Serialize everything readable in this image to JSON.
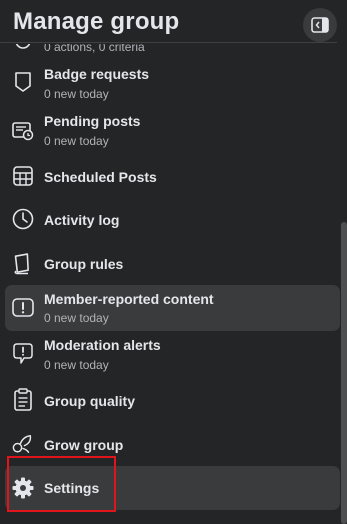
{
  "header": {
    "title": "Manage group"
  },
  "top_partial": {
    "subtitle": "0 actions, 0 criteria"
  },
  "menu": [
    {
      "label": "Badge requests",
      "subtitle": "0 new today",
      "icon": "badge-icon"
    },
    {
      "label": "Pending posts",
      "subtitle": "0 new today",
      "icon": "pending-posts-icon"
    },
    {
      "label": "Scheduled Posts",
      "subtitle": "",
      "icon": "calendar-icon"
    },
    {
      "label": "Activity log",
      "subtitle": "",
      "icon": "clock-icon"
    },
    {
      "label": "Group rules",
      "subtitle": "",
      "icon": "book-icon"
    },
    {
      "label": "Member-reported content",
      "subtitle": "0 new today",
      "icon": "report-icon"
    },
    {
      "label": "Moderation alerts",
      "subtitle": "0 new today",
      "icon": "alert-icon"
    },
    {
      "label": "Group quality",
      "subtitle": "",
      "icon": "clipboard-icon"
    },
    {
      "label": "Grow group",
      "subtitle": "",
      "icon": "grow-icon"
    },
    {
      "label": "Settings",
      "subtitle": "",
      "icon": "gear-icon"
    }
  ],
  "colors": {
    "background": "#242526",
    "active_row": "#3a3b3c",
    "highlight_box": "#e0151b"
  }
}
